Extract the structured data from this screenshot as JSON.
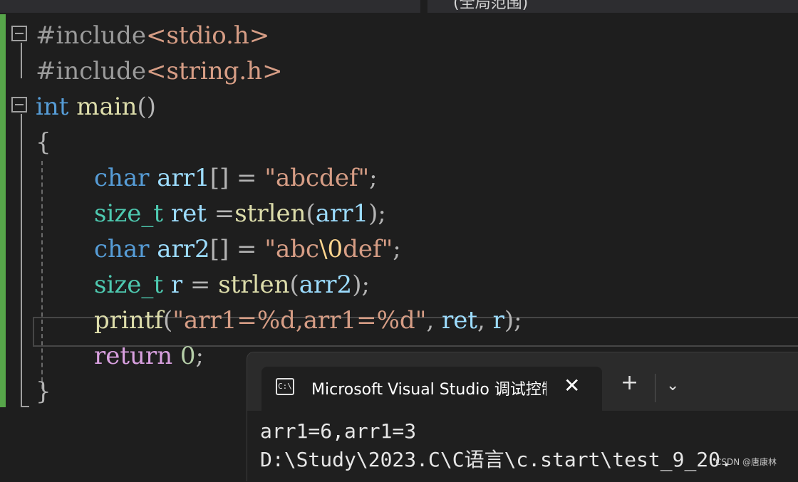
{
  "topbar": {
    "scope": "(全局范围)"
  },
  "code": {
    "l1": {
      "pp": "#include",
      "file": "<stdio.h>"
    },
    "l2": {
      "pp": "#include",
      "file": "<string.h>"
    },
    "l3": {
      "type": "int",
      "fn": "main",
      "rest": "()"
    },
    "l4": "{",
    "l5": {
      "type": "char",
      "var": "arr1",
      "op": "[] =",
      "str": "\"abcdef\"",
      "end": ";"
    },
    "l6": {
      "type": "size_t",
      "var": "ret",
      "op": "=",
      "fn": "strlen",
      "p1": "(",
      "arg": "arr1",
      "p2": ");"
    },
    "l7": {
      "type": "char",
      "var": "arr2",
      "op": "[] =",
      "s1": "\"abc",
      "esc": "\\0",
      "s2": "def\"",
      "end": ";"
    },
    "l8": {
      "type": "size_t",
      "var": "r",
      "op": "=",
      "fn": "strlen",
      "p1": "(",
      "arg": "arr2",
      "p2": ");"
    },
    "l9": {
      "fn": "printf",
      "p1": "(",
      "str": "\"arr1=%d,arr1=%d\"",
      "c1": ",",
      "a1": "ret",
      "c2": ",",
      "a2": "r",
      "p2": ");"
    },
    "l10": {
      "ctl": "return",
      "num": "0",
      "end": ";"
    },
    "l11": "}"
  },
  "terminal": {
    "tab_title": "Microsoft Visual Studio 调试控制台",
    "icon_text": "C:\\",
    "close": "✕",
    "new_tab": "+",
    "dropdown": "⌄",
    "output": [
      "arr1=6,arr1=3",
      "D:\\Study\\2023.C\\C语言\\c.start\\test_9_20."
    ]
  },
  "watermark": "CSDN @唐康林"
}
